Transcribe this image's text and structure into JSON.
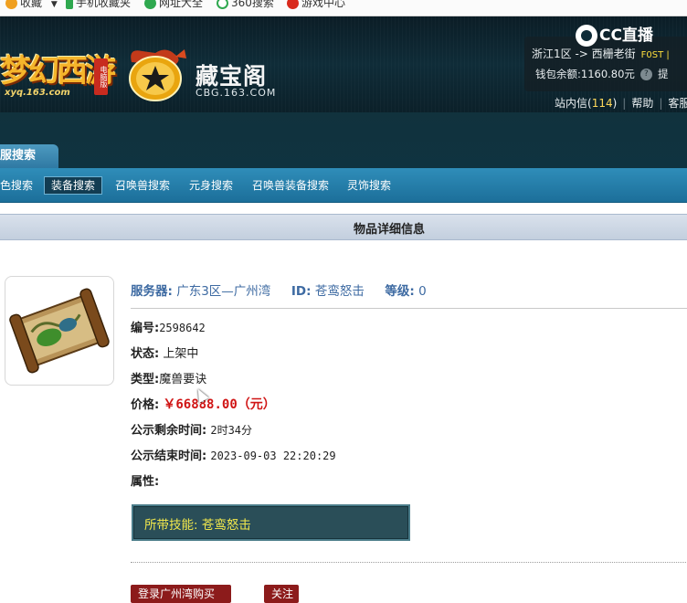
{
  "browser": {
    "bookmarks": [
      {
        "label": "收藏",
        "color": "#f0a020"
      },
      {
        "label": "手机收藏夹",
        "color": "#2fa84f"
      },
      {
        "label": "网址大全",
        "color": "#2fa84f"
      },
      {
        "label": "360搜索",
        "color": "#2fa84f"
      },
      {
        "label": "游戏中心",
        "color": "#d9291c"
      }
    ]
  },
  "header": {
    "xyq_title": "梦幻西游",
    "xyq_tag": "电脑版",
    "xyq_domain": "xyq.163.com",
    "cbg_title": "藏宝阁",
    "cbg_domain": "CBG.163.COM",
    "streamer_logo": "CC直播",
    "server_path": "浙江1区 -> 西栅老街",
    "first_tag": "F0ST |",
    "wallet_label": "钱包余额:",
    "wallet_value": "1160.80元",
    "wallet_help": "?",
    "withdraw": "提",
    "inbox_label": "站内信(",
    "inbox_count": "114",
    "inbox_close": ")",
    "help": "帮助",
    "service": "客服"
  },
  "nav": {
    "main_tab": "服搜索",
    "sub_items": [
      "色搜索",
      "装备搜索",
      "召唤兽搜索",
      "元身搜索",
      "召唤兽装备搜索",
      "灵饰搜索"
    ],
    "active_index": 1
  },
  "page": {
    "title": "物品详细信息"
  },
  "item": {
    "server_label": "服务器:",
    "server_value": "广东3区—广州湾",
    "id_label": "ID:",
    "id_value": "苍鸾怒击",
    "level_label": "等级:",
    "level_value": "0",
    "serial_label": "编号:",
    "serial_value": "2598642",
    "status_label": "状态:",
    "status_value": "上架中",
    "type_label": "类型:",
    "type_value": "魔兽要诀",
    "price_label": "价格:",
    "price_value": "￥66888.00（元）",
    "remain_label": "公示剩余时间:",
    "remain_value": "2时34分",
    "end_label": "公示结束时间:",
    "end_value": "2023-09-03 22:20:29",
    "attr_label": "属性:",
    "skill_text": "所带技能: 苍鸾怒击"
  },
  "actions": {
    "login_buy": "登录广州湾购买",
    "follow": "关注"
  }
}
